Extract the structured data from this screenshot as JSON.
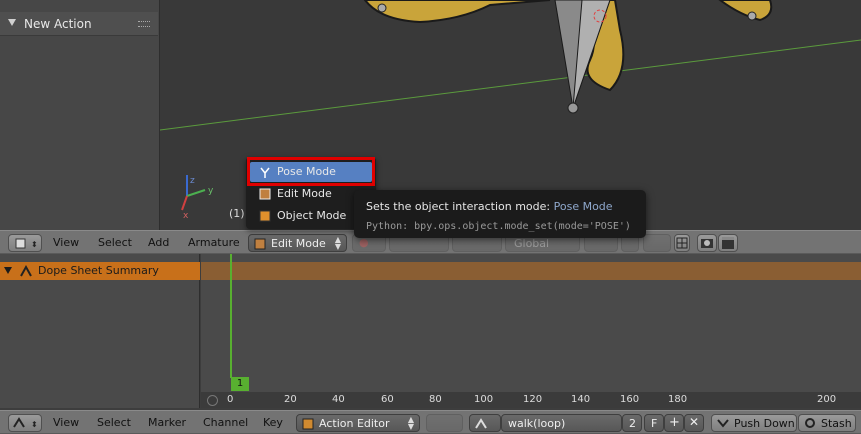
{
  "toolshelf": {
    "panel_title": "New Action"
  },
  "viewport": {
    "frame_label": "(1)"
  },
  "header_3d": {
    "menus": [
      "View",
      "Select",
      "Add",
      "Armature"
    ],
    "mode_dropdown": "Edit Mode",
    "orientation": "Global"
  },
  "mode_menu": {
    "items": [
      {
        "label": "Pose Mode",
        "icon": "pose-mode-icon",
        "highlighted": true
      },
      {
        "label": "Edit Mode",
        "icon": "edit-mode-icon",
        "highlighted": false
      },
      {
        "label": "Object Mode",
        "icon": "object-mode-icon",
        "highlighted": false
      }
    ]
  },
  "tooltip": {
    "prefix": "Sets the object interaction mode:",
    "value": "Pose Mode",
    "python": "Python: bpy.ops.object.mode_set(mode='POSE')"
  },
  "dopesheet": {
    "summary_label": "Dope Sheet Summary",
    "ruler_ticks": [
      "0",
      "20",
      "40",
      "60",
      "80",
      "100",
      "120",
      "140",
      "160",
      "180",
      "200"
    ],
    "current_frame": "1"
  },
  "header_bottom": {
    "menus": [
      "View",
      "Select",
      "Marker",
      "Channel",
      "Key"
    ],
    "editor_mode": "Action Editor",
    "action_name": "walk(loop)",
    "user_count": "2",
    "fake_user": "F",
    "push_down": "Push Down",
    "stash": "Stash"
  },
  "colors": {
    "selection": "#5680c2",
    "highlight_frame": "#e00000",
    "summary": "#c8701a",
    "playhead": "#58b030"
  }
}
